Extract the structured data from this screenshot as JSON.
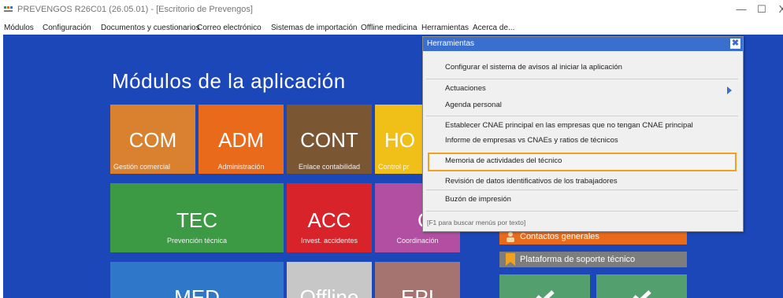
{
  "window": {
    "title": "PREVENGOS R26C01 (26.05.01) - [Escritorio de Prevengos]",
    "minimize": "—",
    "maximize": "☐",
    "close": "X"
  },
  "menubar": [
    "Módulos",
    "Configuración",
    "Documentos y cuestionarios",
    "Correo electrónico",
    "Sistemas de importación",
    "Offline medicina",
    "Herramientas",
    "Acerca de..."
  ],
  "desktop": {
    "heading": "Módulos de la aplicación",
    "tiles": [
      {
        "code": "COM",
        "label": "Gestión comercial",
        "color": "#d9812f"
      },
      {
        "code": "ADM",
        "label": "Administración",
        "color": "#ea6a1b"
      },
      {
        "code": "CONT",
        "label": "Enlace contabilidad",
        "color": "#7b5633"
      },
      {
        "code": "HO",
        "label": "Control pr",
        "color": "#f0c019"
      },
      {
        "code": "TEC",
        "label": "Prevención técnica",
        "color": "#3c9a45"
      },
      {
        "code": "ACC",
        "label": "Invest. accidentes",
        "color": "#d8232a"
      },
      {
        "code": "CA",
        "label": "Coordinación",
        "color": "#b34fa3"
      },
      {
        "code": "MED",
        "label": "",
        "color": "#2f78c9"
      },
      {
        "code": "Offline",
        "label": "",
        "color": "#c7c7c7"
      },
      {
        "code": "EPI",
        "label": "",
        "color": "#a57470"
      }
    ],
    "side_buttons": [
      {
        "label": "Contactos generales",
        "color": "#ea6a1b"
      },
      {
        "label": "Plataforma de soporte técnico",
        "color": "#7d7d7d"
      }
    ],
    "check_color": "#53a06e"
  },
  "popup": {
    "title": "Herramientas",
    "close_label": "✖",
    "items": [
      "Configurar el sistema de avisos al iniciar la aplicación",
      "Actuaciones",
      "Agenda personal",
      "Establecer CNAE principal en las empresas que no tengan CNAE principal",
      "Informe de empresas vs CNAEs y ratios de técnicos",
      "Memoria de actividades del técnico",
      "Revisión de datos identificativos de los trabajadores",
      "Buzón de impresión"
    ],
    "highlighted_item": "Memoria de actividades del técnico",
    "hint": "[F1 para buscar menús por texto]",
    "highlight_color": "#f0a21e"
  }
}
